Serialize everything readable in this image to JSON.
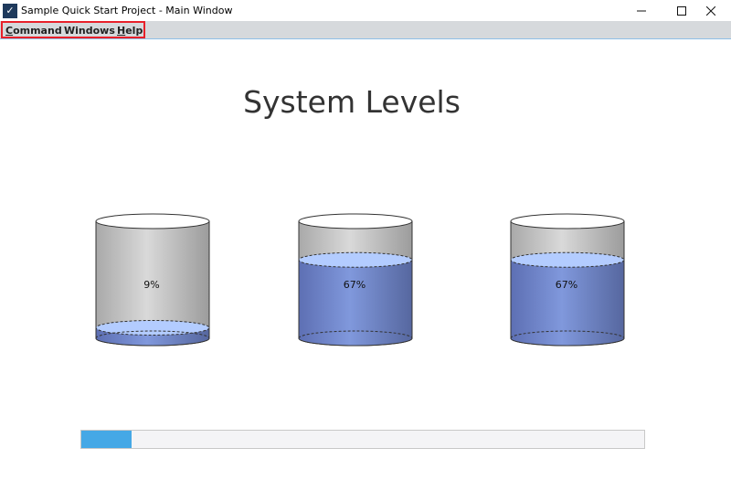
{
  "window": {
    "title": "Sample Quick Start Project - Main Window",
    "icon": "app-check-icon"
  },
  "menu": {
    "items": [
      {
        "label_prefix": "",
        "mnemonic": "C",
        "label_suffix": "ommand"
      },
      {
        "label_prefix": "Windows",
        "mnemonic": "",
        "label_suffix": ""
      },
      {
        "label_prefix": "",
        "mnemonic": "H",
        "label_suffix": "elp"
      }
    ]
  },
  "main": {
    "title": "System Levels",
    "tanks": [
      {
        "label": "9%",
        "level": 0.09
      },
      {
        "label": "67%",
        "level": 0.67
      },
      {
        "label": "67%",
        "level": 0.67
      }
    ],
    "progress": {
      "value": 0.09
    }
  },
  "colors": {
    "liquid": "#7a8fd6",
    "liquid_top": "#b3ccff",
    "progress_fill": "#45a8e6",
    "highlight_border": "#e8202a"
  }
}
